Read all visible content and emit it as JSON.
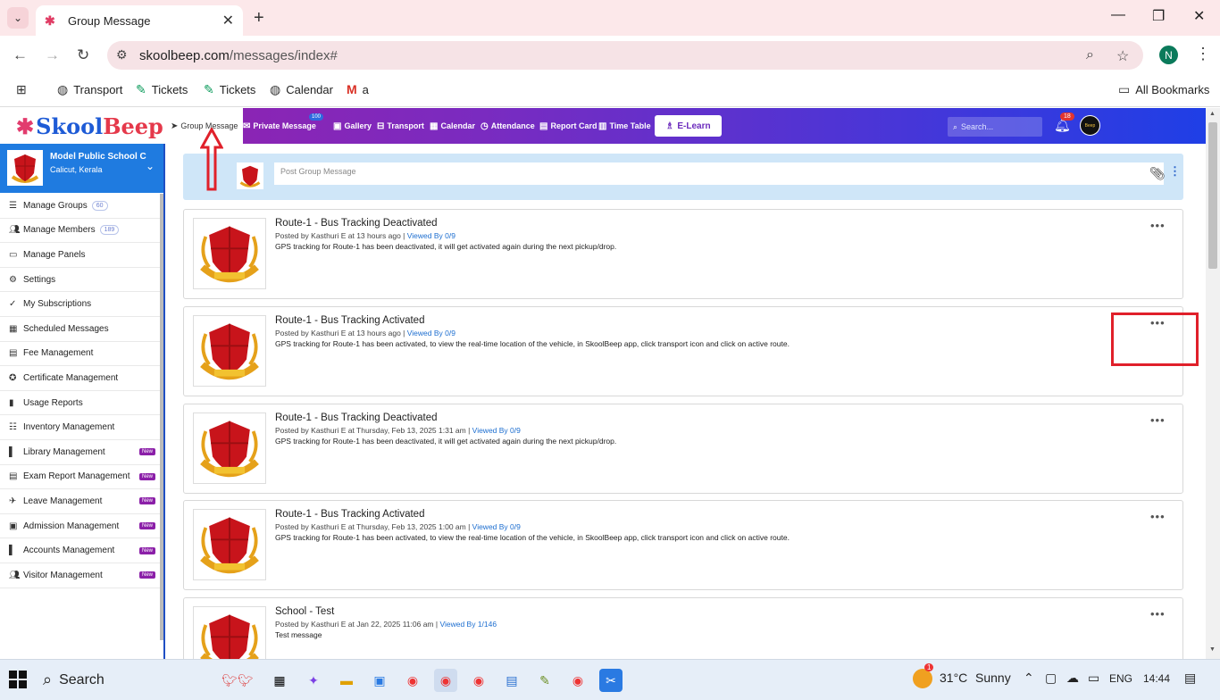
{
  "browser": {
    "tab_title": "Group Message",
    "url_host": "skoolbeep.com",
    "url_path": "/messages/index#",
    "profile_initial": "N",
    "bookmarks": [
      "Transport",
      "Tickets",
      "Tickets",
      "Calendar",
      "a"
    ],
    "all_bookmarks": "All Bookmarks"
  },
  "app": {
    "logo_skool": "Skool",
    "logo_beep": "Beep",
    "nav": [
      {
        "label": "Group Message",
        "icon": "send-icon"
      },
      {
        "label": "Private Message",
        "icon": "mail-icon",
        "badge": "100"
      },
      {
        "label": "Gallery",
        "icon": "image-icon"
      },
      {
        "label": "Transport",
        "icon": "bus-icon"
      },
      {
        "label": "Calendar",
        "icon": "calendar-icon"
      },
      {
        "label": "Attendance",
        "icon": "clock-icon"
      },
      {
        "label": "Report Card",
        "icon": "document-icon"
      },
      {
        "label": "Time Table",
        "icon": "timetable-icon"
      }
    ],
    "elearn": "E-Learn",
    "search_placeholder": "Search...",
    "notification_count": "18",
    "avatar_text": "Beep"
  },
  "sidebar": {
    "school_name": "Model Public School C",
    "school_location": "Calicut, Kerala",
    "items": [
      {
        "label": "Manage Groups",
        "count": "60",
        "new": ""
      },
      {
        "label": "Manage Members",
        "count": "189",
        "new": ""
      },
      {
        "label": "Manage Panels",
        "count": "",
        "new": ""
      },
      {
        "label": "Settings",
        "count": "",
        "new": ""
      },
      {
        "label": "My Subscriptions",
        "count": "",
        "new": ""
      },
      {
        "label": "Scheduled Messages",
        "count": "",
        "new": ""
      },
      {
        "label": "Fee Management",
        "count": "",
        "new": ""
      },
      {
        "label": "Certificate Management",
        "count": "",
        "new": ""
      },
      {
        "label": "Usage Reports",
        "count": "",
        "new": ""
      },
      {
        "label": "Inventory Management",
        "count": "",
        "new": ""
      },
      {
        "label": "Library Management",
        "count": "",
        "new": "New"
      },
      {
        "label": "Exam Report Management",
        "count": "",
        "new": "New"
      },
      {
        "label": "Leave Management",
        "count": "",
        "new": "New"
      },
      {
        "label": "Admission Management",
        "count": "",
        "new": "New"
      },
      {
        "label": "Accounts Management",
        "count": "",
        "new": "New"
      },
      {
        "label": "Visitor Management",
        "count": "",
        "new": "New"
      }
    ]
  },
  "composer": {
    "placeholder": "Post Group Message"
  },
  "messages": [
    {
      "title": "Route-1 - Bus Tracking Deactivated",
      "meta": "Posted by Kasthuri E at 13 hours ago",
      "viewed": "Viewed By 0/9",
      "body": "GPS tracking for Route-1 has been deactivated, it will get activated again during the next pickup/drop."
    },
    {
      "title": "Route-1 - Bus Tracking Activated",
      "meta": "Posted by Kasthuri E at 13 hours ago",
      "viewed": "Viewed By 0/9",
      "body": "GPS tracking for Route-1 has been activated, to view the real-time location of the vehicle, in SkoolBeep app, click transport icon and click on active route."
    },
    {
      "title": "Route-1 - Bus Tracking Deactivated",
      "meta": "Posted by Kasthuri E at Thursday, Feb 13, 2025 1:31 am",
      "viewed": "Viewed By 0/9",
      "body": "GPS tracking for Route-1 has been deactivated, it will get activated again during the next pickup/drop."
    },
    {
      "title": "Route-1 - Bus Tracking Activated",
      "meta": "Posted by Kasthuri E at Thursday, Feb 13, 2025 1:00 am",
      "viewed": "Viewed By 0/9",
      "body": "GPS tracking for Route-1 has been activated, to view the real-time location of the vehicle, in SkoolBeep app, click transport icon and click on active route."
    },
    {
      "title": "School - Test",
      "meta": "Posted by Kasthuri E at Jan 22, 2025 11:06 am",
      "viewed": "Viewed By 1/146",
      "body": "Test message"
    }
  ],
  "taskbar": {
    "search": "Search",
    "temperature": "31°C",
    "weather": "Sunny",
    "weather_alert": "1",
    "language": "ENG",
    "time": "14:44"
  }
}
